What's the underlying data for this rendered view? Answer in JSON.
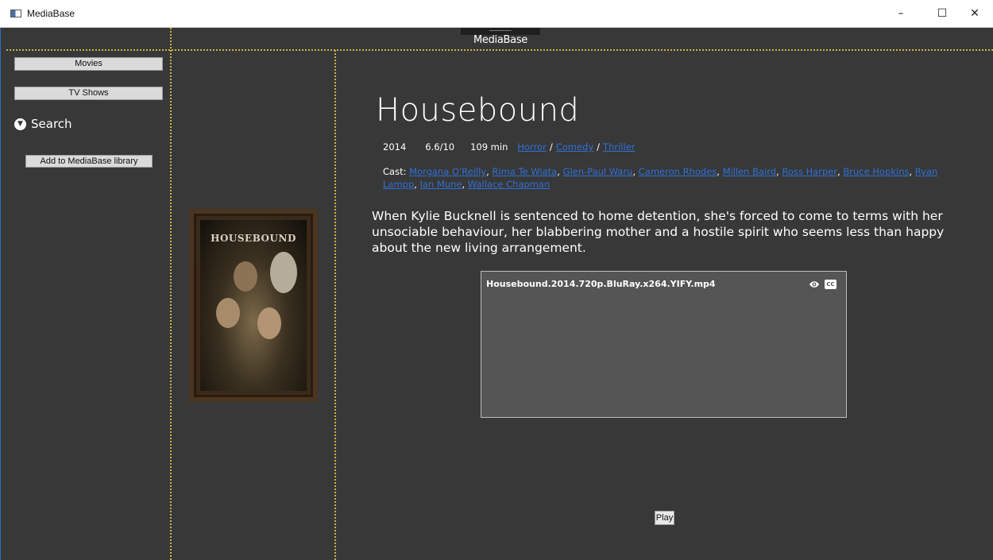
{
  "window": {
    "title": "MediaBase",
    "minimize": "–",
    "maximize": "☐",
    "close": "✕"
  },
  "header": {
    "app_name": "MediaBase"
  },
  "sidebar": {
    "movies_label": "Movies",
    "tv_label": "TV Shows",
    "search_label": "Search",
    "add_label": "Add to MediaBase library"
  },
  "poster": {
    "title_text": "HOUSEBOUND"
  },
  "movie": {
    "title": "Housebound",
    "year": "2014",
    "rating": "6.6/10",
    "runtime": "109 min",
    "genres": [
      "Horror",
      "Comedy",
      "Thriller"
    ],
    "genre_separator": "/",
    "cast_label": "Cast:",
    "cast": [
      "Morgana O'Reilly",
      "Rima Te Wiata",
      "Glen-Paul Waru",
      "Cameron Rhodes",
      "Millen Baird",
      "Ross Harper",
      "Bruce Hopkins",
      "Ryan Lampp",
      "Ian Mune",
      "Wallace Chapman"
    ],
    "synopsis": "When Kylie Bucknell is sentenced to home detention, she's forced to come to terms with her unsociable behaviour, her blabbering mother and a hostile spirit who seems less than happy about the new living arrangement."
  },
  "files": {
    "items": [
      {
        "name": "Housebound.2014.720p.BluRay.x264.YIFY.mp4",
        "cc_label": "CC"
      }
    ]
  },
  "play_label": "Play",
  "colors": {
    "background": "#383838",
    "link": "#2f6fd6",
    "grid_line": "#c9b44a",
    "panel": "#555555"
  }
}
